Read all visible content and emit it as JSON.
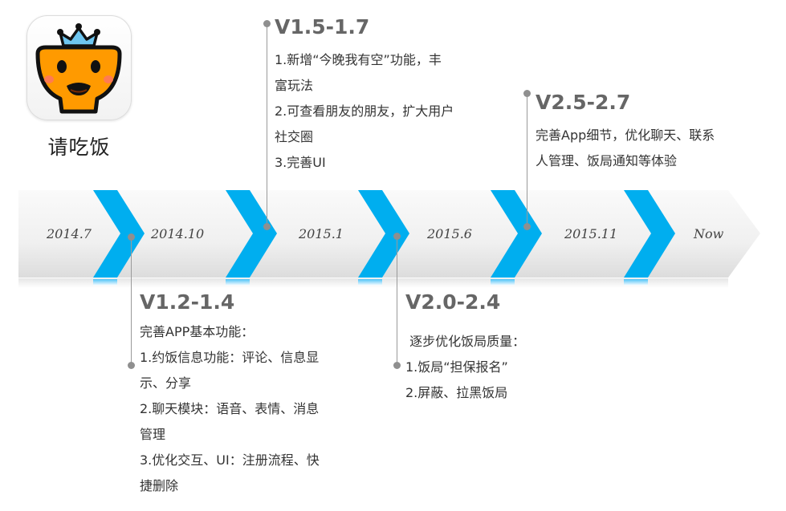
{
  "app": {
    "name": "请吃饭",
    "colors": {
      "face": "#FF9A00",
      "crown": "#6EC6F0",
      "outline": "#111111",
      "cheek": "#FF7B52"
    }
  },
  "timeline": {
    "colors": {
      "band_top": "#FAFAFA",
      "band_bottom": "#E4E4E4",
      "chevron": "#00AEEF"
    },
    "dates": [
      "2014.7",
      "2014.10",
      "2015.1",
      "2015.6",
      "2015.11",
      "Now"
    ]
  },
  "milestones": {
    "v12": {
      "title": "V1.2-1.4",
      "lines": [
        "完善APP基本功能：",
        "1.约饭信息功能：评论、信息显",
        "示、分享",
        "2.聊天模块：语音、表情、消息",
        "管理",
        "3.优化交互、UI：注册流程、快",
        "捷删除"
      ]
    },
    "v15": {
      "title": "V1.5-1.7",
      "lines": [
        "1.新增“今晚我有空”功能，丰",
        "富玩法",
        "2.可查看朋友的朋友，扩大用户",
        "社交圈",
        "3.完善UI"
      ]
    },
    "v20": {
      "title": "V2.0-2.4",
      "lines": [
        " 逐步优化饭局质量：",
        "1.饭局“担保报名”",
        "2.屏蔽、拉黑饭局"
      ]
    },
    "v25": {
      "title": "V2.5-2.7",
      "lines": [
        "完善App细节，优化聊天、联系",
        "人管理、饭局通知等体验"
      ]
    }
  }
}
